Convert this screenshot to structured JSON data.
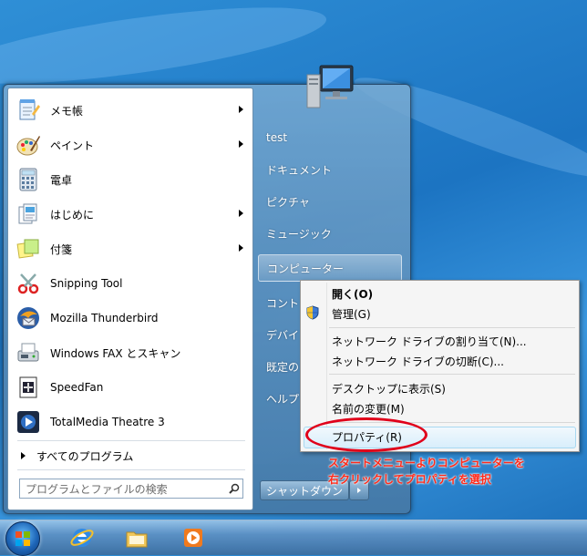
{
  "programs": [
    {
      "label": "メモ帳",
      "icon": "notepad-icon",
      "has_arrow": true
    },
    {
      "label": "ペイント",
      "icon": "paint-icon",
      "has_arrow": true
    },
    {
      "label": "電卓",
      "icon": "calculator-icon",
      "has_arrow": false
    },
    {
      "label": "はじめに",
      "icon": "getting-started-icon",
      "has_arrow": true
    },
    {
      "label": "付箋",
      "icon": "sticky-notes-icon",
      "has_arrow": true
    },
    {
      "label": "Snipping Tool",
      "icon": "snipping-tool-icon",
      "has_arrow": false
    },
    {
      "label": "Mozilla Thunderbird",
      "icon": "thunderbird-icon",
      "has_arrow": false
    },
    {
      "label": "Windows FAX とスキャン",
      "icon": "fax-scan-icon",
      "has_arrow": false
    },
    {
      "label": "SpeedFan",
      "icon": "speedfan-icon",
      "has_arrow": false
    },
    {
      "label": "TotalMedia Theatre 3",
      "icon": "totalmedia-icon",
      "has_arrow": false
    }
  ],
  "all_programs": "すべてのプログラム",
  "search_placeholder": "プログラムとファイルの検索",
  "right_items": [
    "test",
    "ドキュメント",
    "ピクチャ",
    "ミュージック",
    "コンピューター",
    "コント",
    "デバイ",
    "既定の",
    "ヘルプ"
  ],
  "shutdown_label": "シャットダウン",
  "context_menu": [
    {
      "label": "開く(O)",
      "bold": true
    },
    {
      "label": "管理(G)",
      "icon": "uac-shield-icon"
    },
    {
      "label": "ネットワーク ドライブの割り当て(N)..."
    },
    {
      "label": "ネットワーク ドライブの切断(C)..."
    },
    {
      "label": "デスクトップに表示(S)"
    },
    {
      "label": "名前の変更(M)"
    },
    {
      "label": "プロパティ(R)"
    }
  ],
  "annotation": {
    "line1": "スタートメニューよりコンピューターを",
    "line2": "右クリックしてプロパティを選択"
  },
  "taskbar": [
    "start-orb-icon",
    "internet-explorer-icon",
    "explorer-folder-icon",
    "media-player-icon"
  ],
  "colors": {
    "annotation": "#ff2a1a",
    "highlight_ellipse": "#e0001a"
  }
}
